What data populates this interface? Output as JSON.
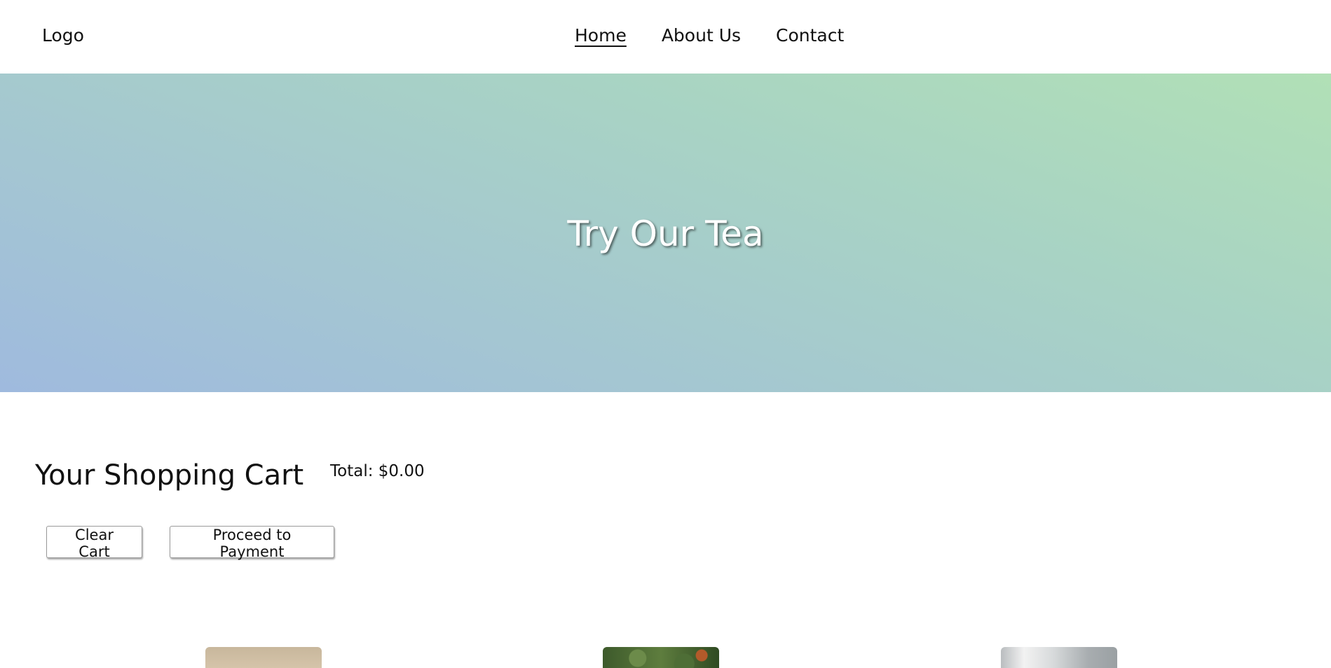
{
  "header": {
    "logo": "Logo",
    "nav": [
      {
        "label": "Home",
        "active": true
      },
      {
        "label": "About Us",
        "active": false
      },
      {
        "label": "Contact",
        "active": false
      }
    ]
  },
  "hero": {
    "title": "Try Our Tea",
    "gradient_colors": [
      "#b1e0b6",
      "#a8d3c4",
      "#a4c6d2",
      "#9fbade"
    ]
  },
  "cart": {
    "title": "Your Shopping Cart",
    "total": "Total: $0.00",
    "clear_label": "Clear Cart",
    "pay_label": "Proceed to Payment"
  },
  "products": [
    {
      "image": "tea-product-image"
    },
    {
      "image": "tea-product-image"
    },
    {
      "image": "tea-product-image"
    }
  ]
}
